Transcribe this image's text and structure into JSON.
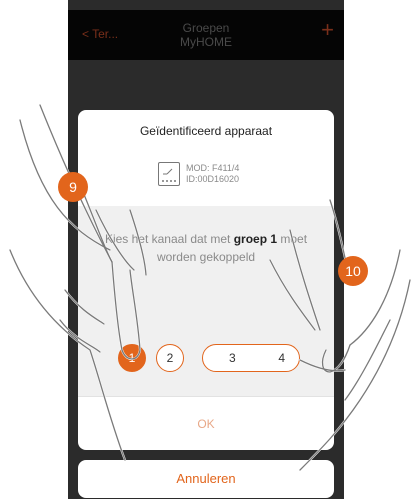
{
  "navbar": {
    "back_label": "< Ter...",
    "title": "Groepen",
    "subtitle": "MyHOME",
    "add_label": "+"
  },
  "dialog": {
    "title": "Geïdentificeerd apparaat",
    "device_model": "MOD: F411/4",
    "device_id": "ID:00D16020",
    "instruction_pre": "Kies het kanaal dat met ",
    "instruction_bold": "groep 1",
    "instruction_post": " moet worden gekoppeld",
    "channels": [
      "1",
      "2",
      "3",
      "4"
    ],
    "ok_label": "OK",
    "cancel_label": "Annuleren"
  },
  "markers": [
    "9",
    "10"
  ],
  "colors": {
    "accent": "#e2651c",
    "background": "#2b2b2b"
  }
}
